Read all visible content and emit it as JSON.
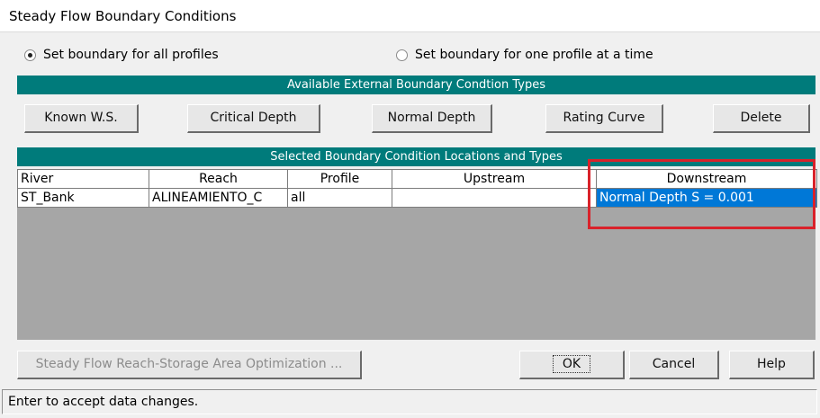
{
  "window": {
    "title": "Steady Flow Boundary Conditions"
  },
  "mode": {
    "all_profiles_label": "Set boundary for all profiles",
    "one_profile_label": "Set boundary for one profile at a time",
    "selected": "all_profiles"
  },
  "types_section": {
    "title": "Available External Boundary Condtion Types"
  },
  "type_buttons": {
    "known_ws": "Known W.S.",
    "critical_depth": "Critical Depth",
    "normal_depth": "Normal Depth",
    "rating_curve": "Rating Curve",
    "delete": "Delete"
  },
  "locations_section": {
    "title": "Selected Boundary Condition Locations and Types"
  },
  "table": {
    "headers": {
      "river": "River",
      "reach": "Reach",
      "profile": "Profile",
      "upstream": "Upstream",
      "downstream": "Downstream"
    },
    "rows": [
      {
        "river": "ST_Bank",
        "reach": "ALINEAMIENTO_C",
        "profile": "all",
        "upstream": "",
        "downstream": "Normal Depth S = 0.001"
      }
    ]
  },
  "bottom_buttons": {
    "optimization": "Steady Flow Reach-Storage Area Optimization ...",
    "ok": "OK",
    "cancel": "Cancel",
    "help": "Help"
  },
  "status": {
    "text": "Enter to accept data changes."
  },
  "colors": {
    "band": "#007b7b",
    "selection": "#0078d7",
    "highlight": "#d9222a",
    "grid_background": "#a6a6a6"
  }
}
